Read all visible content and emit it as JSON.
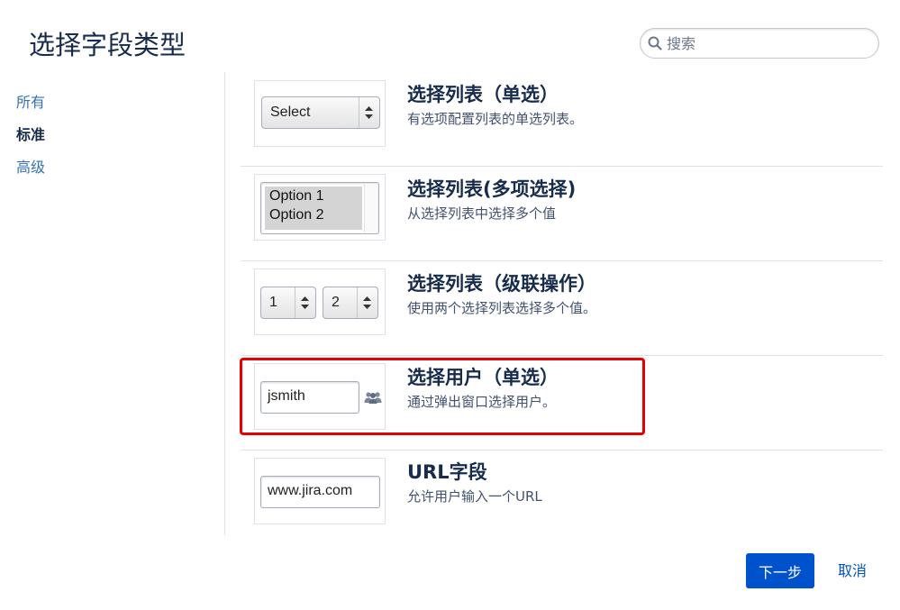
{
  "header": {
    "title": "选择字段类型",
    "search_placeholder": "搜索"
  },
  "sidebar": {
    "items": [
      {
        "label": "所有",
        "active": false
      },
      {
        "label": "标准",
        "active": true
      },
      {
        "label": "高级",
        "active": false
      }
    ]
  },
  "field_types": [
    {
      "title": "选择列表（单选）",
      "description": "有选项配置列表的单选列表。",
      "preview": {
        "select_value": "Select"
      }
    },
    {
      "title": "选择列表(多项选择)",
      "description": "从选择列表中选择多个值",
      "preview": {
        "options": [
          "Option 1",
          "Option 2"
        ]
      }
    },
    {
      "title": "选择列表（级联操作）",
      "description": "使用两个选择列表选择多个值。",
      "preview": {
        "first_value": "1",
        "second_value": "2"
      }
    },
    {
      "title": "选择用户（单选）",
      "description": "通过弹出窗口选择用户。",
      "preview": {
        "input_value": "jsmith",
        "icon": "users-icon"
      },
      "highlighted": true
    },
    {
      "title": "URL字段",
      "description": "允许用户输入一个URL",
      "preview": {
        "input_value": "www.jira.com"
      }
    }
  ],
  "footer": {
    "next_label": "下一步",
    "cancel_label": "取消"
  },
  "colors": {
    "primary": "#0052cc",
    "link": "#3572b0",
    "highlight": "#e60000",
    "text": "#172b4d"
  }
}
